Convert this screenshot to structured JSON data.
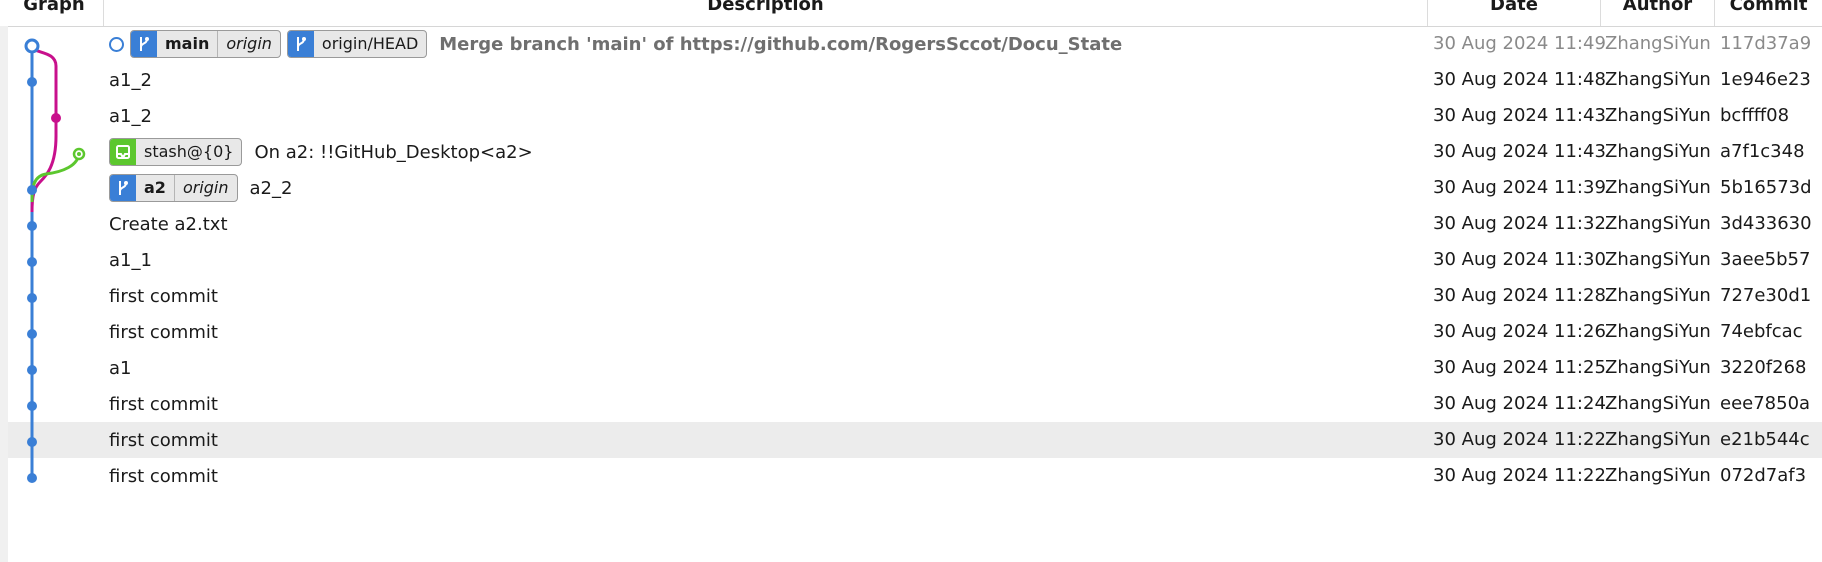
{
  "columns": {
    "graph": "Graph",
    "description": "Description",
    "date": "Date",
    "author": "Author",
    "commit": "Commit"
  },
  "colors": {
    "blue": "#3a7fd6",
    "magenta": "#c8108c",
    "green": "#5cc72e",
    "selection": "#ececec"
  },
  "rows": [
    {
      "refs": [
        {
          "type": "branch",
          "name": "main",
          "remote": "origin"
        },
        {
          "type": "branch",
          "name": "origin/HEAD"
        }
      ],
      "message": "Merge branch 'main' of https://github.com/RogersSccot/Docu_State",
      "date": "30 Aug 2024 11:49",
      "author": "ZhangSiYun",
      "commit": "117d37a9",
      "muted": true
    },
    {
      "message": "a1_2",
      "date": "30 Aug 2024 11:48",
      "author": "ZhangSiYun",
      "commit": "1e946e23"
    },
    {
      "message": "a1_2",
      "date": "30 Aug 2024 11:43",
      "author": "ZhangSiYun",
      "commit": "bcffff08"
    },
    {
      "refs": [
        {
          "type": "stash",
          "name": "stash@{0}"
        }
      ],
      "message": "On a2: !!GitHub_Desktop<a2>",
      "date": "30 Aug 2024 11:43",
      "author": "ZhangSiYun",
      "commit": "a7f1c348"
    },
    {
      "refs": [
        {
          "type": "branch",
          "name": "a2",
          "remote": "origin"
        }
      ],
      "message": "a2_2",
      "date": "30 Aug 2024 11:39",
      "author": "ZhangSiYun",
      "commit": "5b16573d"
    },
    {
      "message": "Create a2.txt",
      "date": "30 Aug 2024 11:32",
      "author": "ZhangSiYun",
      "commit": "3d433630"
    },
    {
      "message": "a1_1",
      "date": "30 Aug 2024 11:30",
      "author": "ZhangSiYun",
      "commit": "3aee5b57"
    },
    {
      "message": "first commit",
      "date": "30 Aug 2024 11:28",
      "author": "ZhangSiYun",
      "commit": "727e30d1"
    },
    {
      "message": "first commit",
      "date": "30 Aug 2024 11:26",
      "author": "ZhangSiYun",
      "commit": "74ebfcac"
    },
    {
      "message": "a1",
      "date": "30 Aug 2024 11:25",
      "author": "ZhangSiYun",
      "commit": "3220f268"
    },
    {
      "message": "first commit",
      "date": "30 Aug 2024 11:24",
      "author": "ZhangSiYun",
      "commit": "eee7850a"
    },
    {
      "message": "first commit",
      "date": "30 Aug 2024 11:22",
      "author": "ZhangSiYun",
      "commit": "e21b544c",
      "selected": true
    },
    {
      "message": "first commit",
      "date": "30 Aug 2024 11:22",
      "author": "ZhangSiYun",
      "commit": "072d7af3"
    }
  ]
}
